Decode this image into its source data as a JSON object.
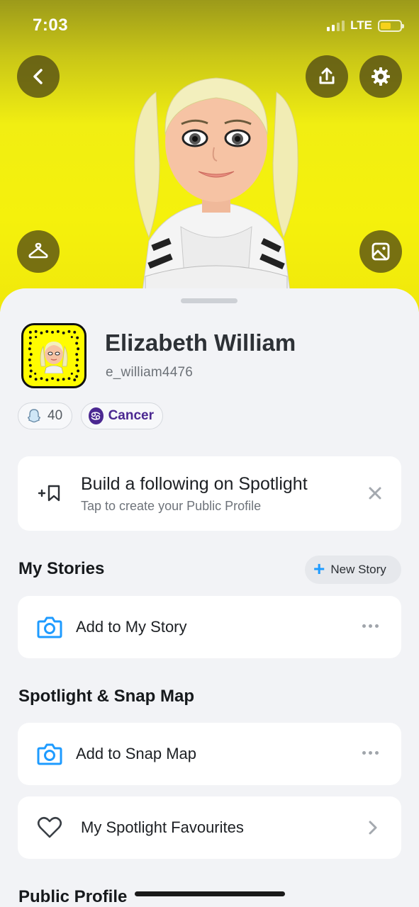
{
  "status_bar": {
    "time": "7:03",
    "network": "LTE",
    "battery_percent": 55
  },
  "header": {
    "back_icon": "chevron-left-icon",
    "share_icon": "share-upload-icon",
    "settings_icon": "gear-icon",
    "outfit_icon": "hanger-icon",
    "photo_icon": "image-icon"
  },
  "profile": {
    "display_name": "Elizabeth William",
    "username": "e_william4476",
    "snap_score": "40",
    "zodiac": "Cancer"
  },
  "spotlight_prompt": {
    "title": "Build a following on Spotlight",
    "subtitle": "Tap to create your Public Profile"
  },
  "my_stories": {
    "title": "My Stories",
    "new_story_label": "New Story",
    "add_story_label": "Add to My Story"
  },
  "spotlight_map": {
    "title": "Spotlight & Snap Map",
    "add_map_label": "Add to Snap Map",
    "favourites_label": "My Spotlight Favourites"
  },
  "public_profile": {
    "title": "Public Profile"
  },
  "colors": {
    "accent_blue": "#1e9bff",
    "zodiac_purple": "#4b2891",
    "snap_yellow": "#fffc00"
  }
}
